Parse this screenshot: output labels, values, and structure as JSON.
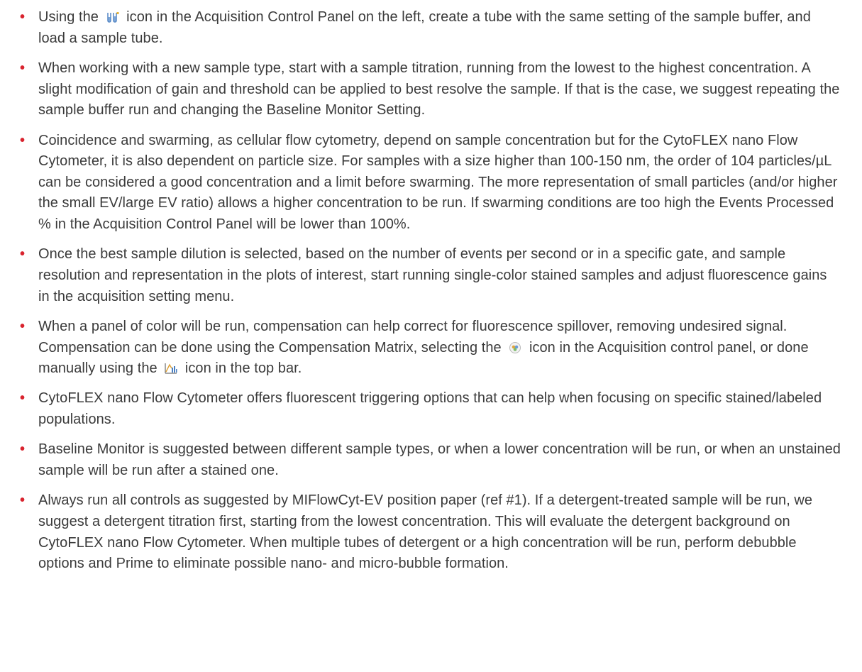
{
  "bullet_symbol": "•",
  "icons": {
    "tube": "tube-icon",
    "compensation": "compensation-matrix-icon",
    "manual_comp": "manual-compensation-icon"
  },
  "colors": {
    "bullet": "#d9232e",
    "text": "#3b3b3b",
    "icon_blue": "#4a7fc1"
  },
  "items": [
    {
      "before": "Using the",
      "after": "icon in the Acquisition Control Panel on the left, create a tube with the same setting of the sample buffer, and load a sample tube."
    },
    {
      "text": "When working with a new sample type, start with a sample titration, running from the lowest to the highest concentration. A slight modification of gain and threshold can be applied to best resolve the sample. If that is the case, we suggest repeating the sample buffer run and changing the Baseline Monitor Setting."
    },
    {
      "text": "Coincidence and swarming, as cellular flow cytometry, depend on sample concentration but for the CytoFLEX nano Flow Cytometer, it is also dependent on particle size. For samples with a size higher than 100-150 nm, the order of 104 particles/µL can be considered a good concentration and a limit before swarming. The more representation of small particles (and/or higher the small EV/large EV ratio) allows a higher concentration to be run. If swarming conditions are too high the Events Processed % in the Acquisition Control Panel will be lower than 100%."
    },
    {
      "text": "Once the best sample dilution is selected, based on the number of events per second or in a specific gate, and sample resolution and representation in the plots of interest, start running single-color stained samples and adjust fluorescence gains in the acquisition setting menu."
    },
    {
      "before": "When a panel of color will be run, compensation can help correct for fluorescence spillover, removing undesired signal. Compensation can be done using the Compensation Matrix, selecting the",
      "middle": "icon in the Acquisition control panel, or done manually using the",
      "after": "icon in the top bar."
    },
    {
      "text": "CytoFLEX nano Flow Cytometer offers fluorescent triggering options that can help when focusing on specific stained/labeled populations."
    },
    {
      "text": "Baseline Monitor is suggested between different sample types, or when a lower concentration will be run, or when an unstained sample will be run after a stained one."
    },
    {
      "text": "Always run all controls as suggested by MIFlowCyt-EV position paper (ref #1). If a detergent-treated sample will be run, we suggest a detergent titration first, starting from the lowest concentration. This will evaluate the detergent background on CytoFLEX nano Flow Cytometer. When multiple tubes of detergent or a high concentration will be run, perform debubble options and Prime to eliminate possible nano- and micro-bubble formation."
    }
  ]
}
